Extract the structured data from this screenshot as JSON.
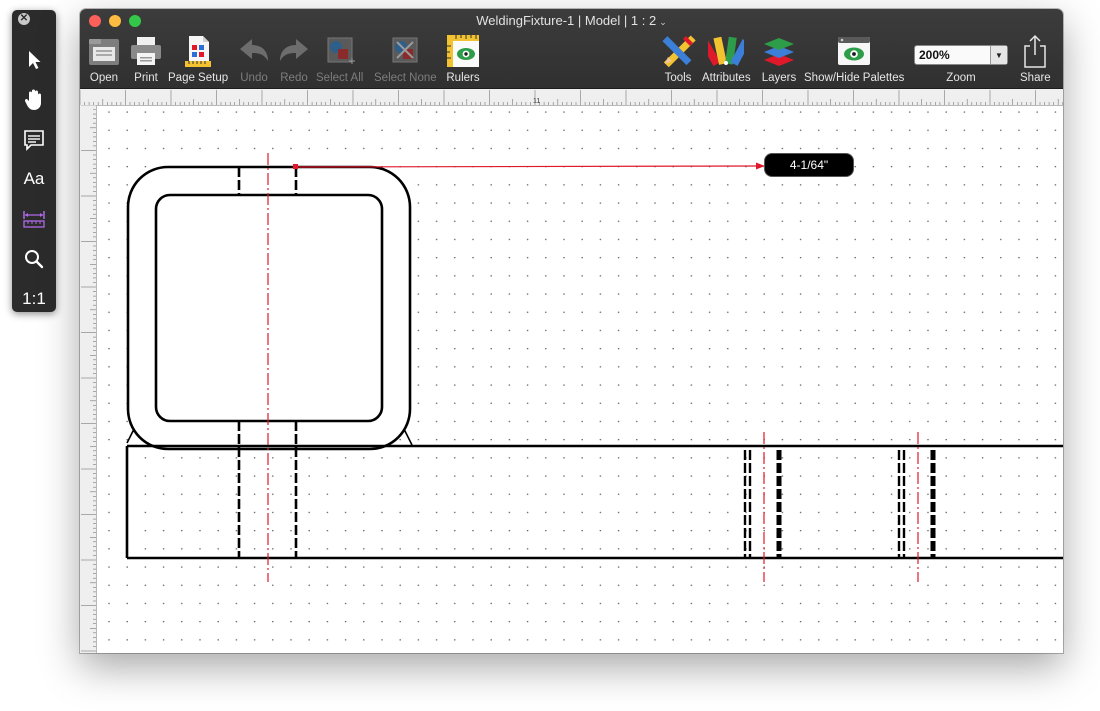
{
  "window": {
    "title": "WeldingFixture-1 | Model | 1 : 2"
  },
  "toolbar": {
    "open": "Open",
    "print": "Print",
    "page_setup": "Page Setup",
    "undo": "Undo",
    "redo": "Redo",
    "select_all": "Select All",
    "select_none": "Select None",
    "rulers": "Rulers",
    "tools": "Tools",
    "attributes": "Attributes",
    "layers": "Layers",
    "show_hide_palettes": "Show/Hide Palettes",
    "zoom_label": "Zoom",
    "zoom_value": "200%",
    "share": "Share"
  },
  "palette": {
    "text_tool": "Aa",
    "actual_size": "1:1"
  },
  "ruler": {
    "mark": "11"
  },
  "drawing": {
    "dimension_label": "4-1/64\""
  },
  "colors": {
    "accent_red": "#e0192a",
    "close": "#fc605b",
    "minimize": "#fdbc40",
    "zoom": "#34c84a"
  }
}
